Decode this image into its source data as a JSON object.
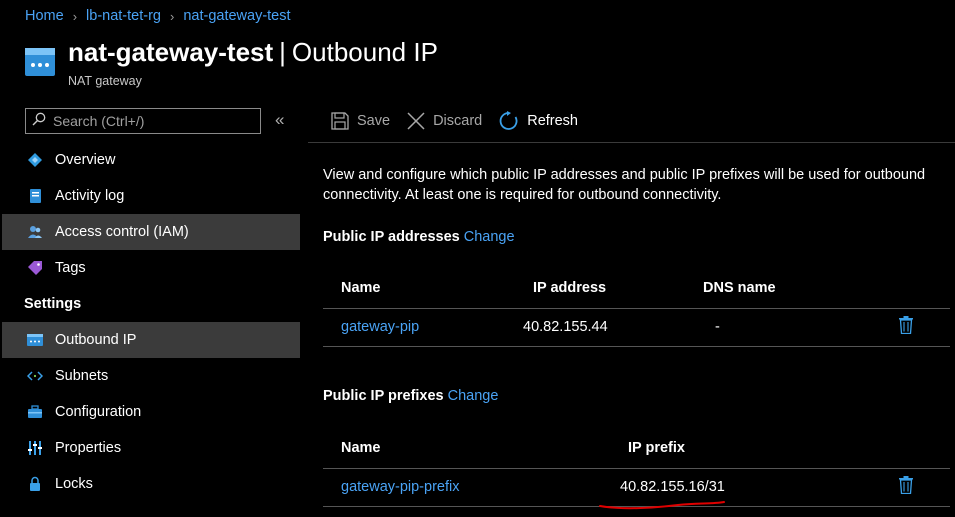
{
  "breadcrumb": {
    "items": [
      "Home",
      "lb-nat-tet-rg",
      "nat-gateway-test"
    ]
  },
  "header": {
    "resource_name": "nat-gateway-test",
    "separator": "|",
    "page_name": "Outbound IP",
    "subtitle": "NAT gateway",
    "icon": "nat-gateway-icon"
  },
  "sidebar": {
    "search_placeholder": "Search (Ctrl+/)",
    "collapse_glyph": "«",
    "items": [
      {
        "label": "Overview",
        "icon": "overview-icon"
      },
      {
        "label": "Activity log",
        "icon": "activity-log-icon"
      },
      {
        "label": "Access control (IAM)",
        "icon": "iam-icon"
      },
      {
        "label": "Tags",
        "icon": "tag-icon"
      }
    ],
    "section_settings": "Settings",
    "settings_items": [
      {
        "label": "Outbound IP",
        "icon": "outbound-ip-icon"
      },
      {
        "label": "Subnets",
        "icon": "subnets-icon"
      },
      {
        "label": "Configuration",
        "icon": "configuration-icon"
      },
      {
        "label": "Properties",
        "icon": "properties-icon"
      },
      {
        "label": "Locks",
        "icon": "lock-icon"
      }
    ]
  },
  "toolbar": {
    "save_label": "Save",
    "discard_label": "Discard",
    "refresh_label": "Refresh"
  },
  "main": {
    "description": "View and configure which public IP addresses and public IP prefixes will be used for outbound connectivity. At least one is required for outbound connectivity.",
    "public_ips": {
      "title": "Public IP addresses",
      "change_link": "Change",
      "columns": [
        "Name",
        "IP address",
        "DNS name"
      ],
      "rows": [
        {
          "name": "gateway-pip",
          "ip_address": "40.82.155.44",
          "dns_name": "-"
        }
      ]
    },
    "public_prefixes": {
      "title": "Public IP prefixes",
      "change_link": "Change",
      "columns": [
        "Name",
        "IP prefix"
      ],
      "rows": [
        {
          "name": "gateway-pip-prefix",
          "ip_prefix": "40.82.155.16/31"
        }
      ]
    }
  },
  "colors": {
    "link": "#4aa3f5",
    "background": "#000000",
    "active_nav": "#3b3b3b",
    "annotation": "#e00000"
  }
}
